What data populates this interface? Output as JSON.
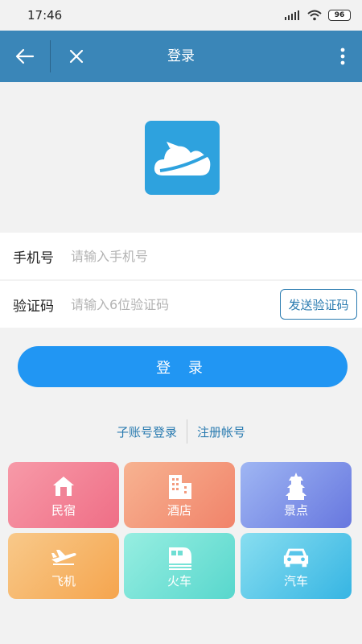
{
  "status": {
    "time": "17:46",
    "battery": "96"
  },
  "nav": {
    "title": "登录",
    "icons": {
      "back": "arrow-left-icon",
      "close": "close-icon",
      "more": "more-vertical-icon"
    }
  },
  "logo": {
    "icon": "cloud-plane-logo",
    "color": "#2ea2de"
  },
  "form": {
    "phone": {
      "label": "手机号",
      "placeholder": "请输入手机号",
      "value": ""
    },
    "code": {
      "label": "验证码",
      "placeholder": "请输入6位验证码",
      "value": "",
      "send_label": "发送验证码"
    }
  },
  "login_button": {
    "label": "登 录",
    "color": "#2196f3"
  },
  "links": {
    "sub_account": "子账号登录",
    "register": "注册帐号"
  },
  "services": [
    {
      "label": "民宿",
      "icon": "house-icon"
    },
    {
      "label": "酒店",
      "icon": "building-icon"
    },
    {
      "label": "景点",
      "icon": "pagoda-icon"
    },
    {
      "label": "飞机",
      "icon": "airplane-icon"
    },
    {
      "label": "火车",
      "icon": "train-icon"
    },
    {
      "label": "汽车",
      "icon": "car-icon"
    }
  ]
}
